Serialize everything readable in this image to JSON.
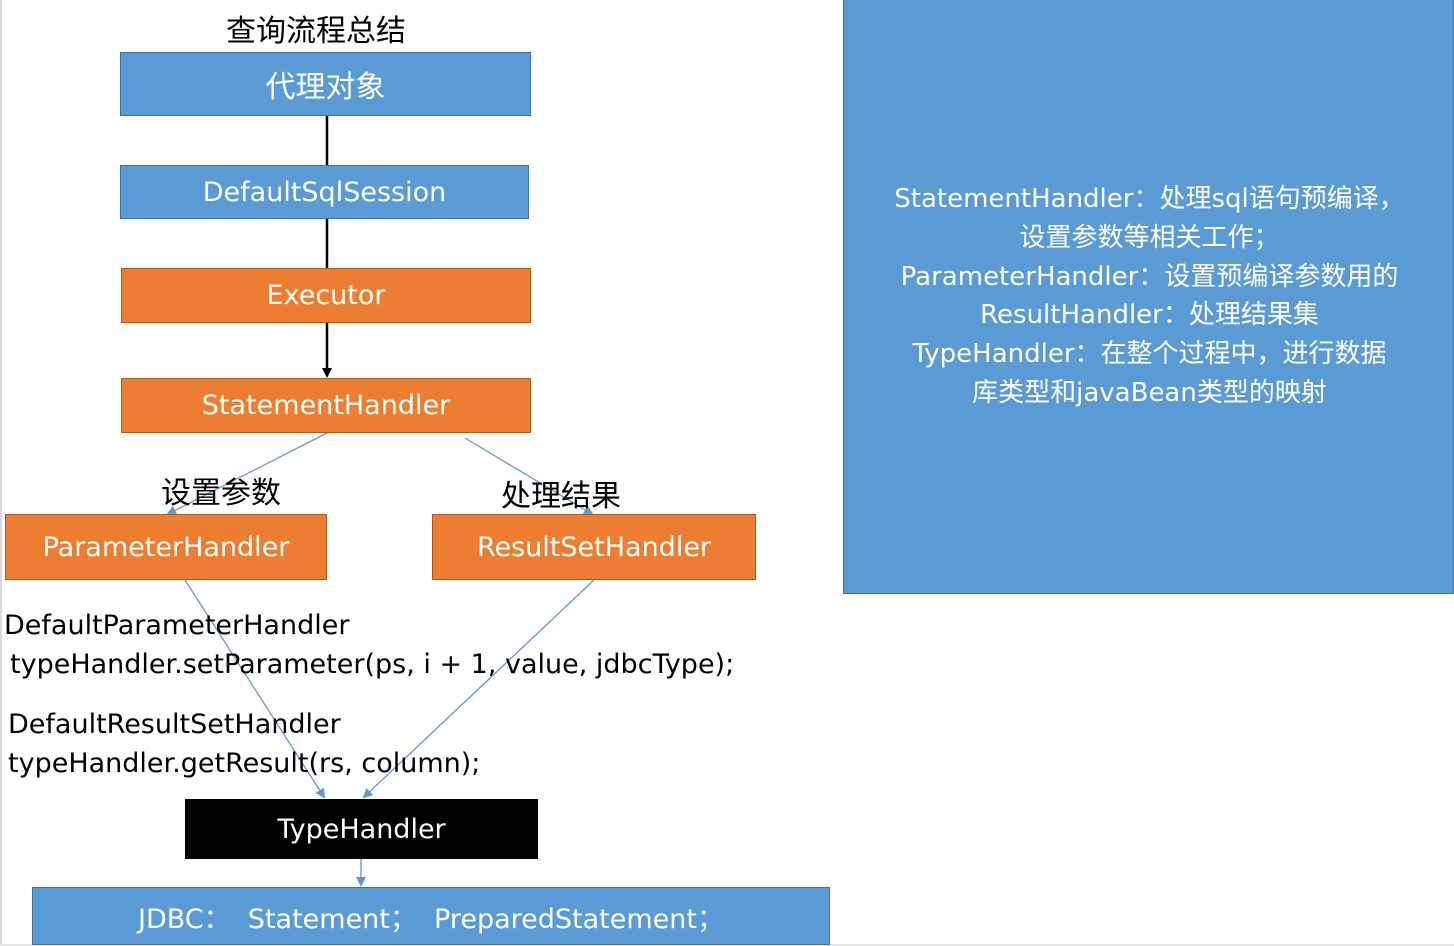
{
  "diagram": {
    "title": "查询流程总结",
    "nodes": {
      "proxy": "代理对象",
      "session": "DefaultSqlSession",
      "executor": "Executor",
      "statement_handler": "StatementHandler",
      "parameter_handler": "ParameterHandler",
      "resultset_handler": "ResultSetHandler",
      "type_handler": "TypeHandler",
      "jdbc": "JDBC：  Statement；  PreparedStatement；"
    },
    "edge_labels": {
      "set_params": "设置参数",
      "handle_results": "处理结果"
    },
    "code_notes": {
      "param_class": "DefaultParameterHandler",
      "param_call": "typeHandler.setParameter(ps, i + 1, value, jdbcType);",
      "result_class": "DefaultResultSetHandler",
      "result_call": "typeHandler.getResult(rs, column);"
    },
    "notes_lines": [
      "StatementHandler：处理sql语句预编译，",
      "设置参数等相关工作；",
      "ParameterHandler：设置预编译参数用的",
      "ResultHandler：处理结果集",
      "TypeHandler：在整个过程中，进行数据",
      "库类型和javaBean类型的映射"
    ],
    "colors": {
      "blue": "#5b9bd5",
      "orange": "#ed7d31",
      "black": "#000000",
      "connector": "#5b9bd5"
    }
  }
}
